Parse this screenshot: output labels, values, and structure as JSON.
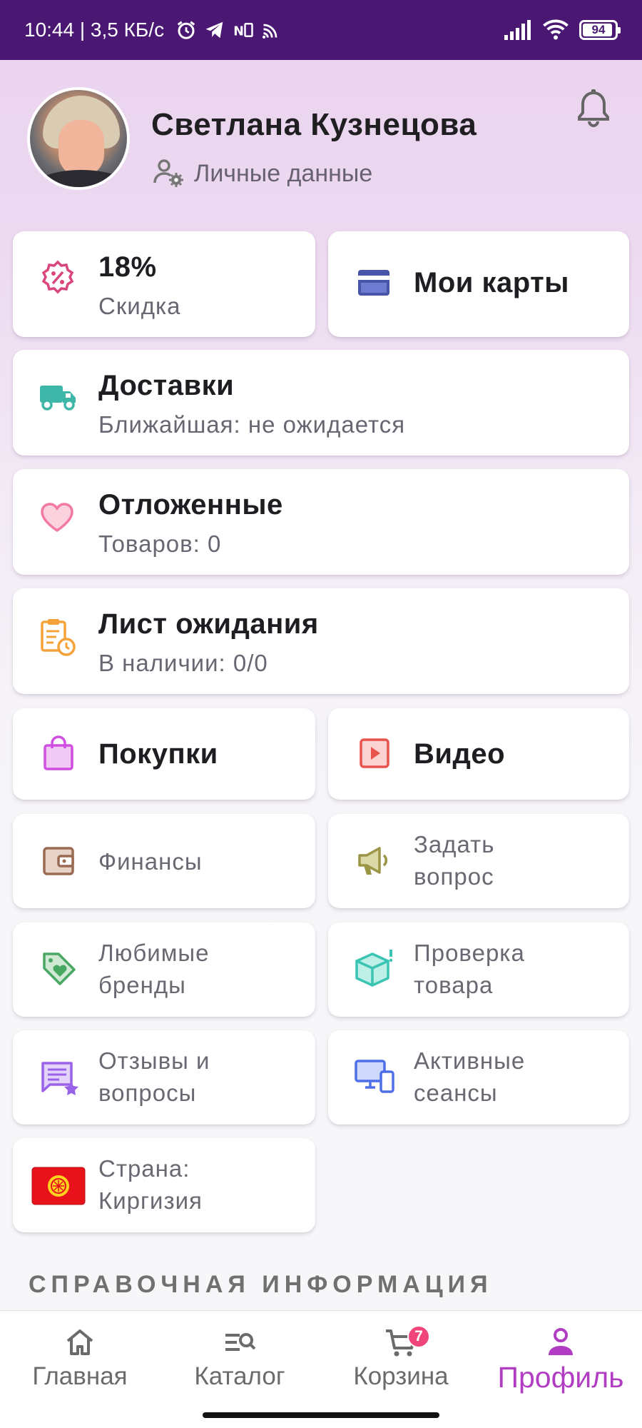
{
  "status_bar": {
    "time_speed": "10:44 | 3,5 КБ/с",
    "battery": "94",
    "battery_level": 0.94
  },
  "profile": {
    "name": "Светлана Кузнецова",
    "personal_data_link": "Личные данные"
  },
  "cards": {
    "discount": {
      "value": "18%",
      "label": "Скидка",
      "icon": "discount-badge-icon",
      "color": "#d9467e"
    },
    "my_cards": {
      "label": "Мои карты",
      "icon": "credit-card-icon",
      "color": "#4754a8"
    },
    "deliveries": {
      "title": "Доставки",
      "subtitle": "Ближайшая: не ожидается",
      "icon": "truck-icon",
      "color": "#3fb7a8"
    },
    "postponed": {
      "title": "Отложенные",
      "subtitle": "Товаров: 0",
      "icon": "heart-icon",
      "color": "#f07aa0"
    },
    "waitlist": {
      "title": "Лист ожидания",
      "subtitle": "В наличии: 0/0",
      "icon": "clipboard-clock-icon",
      "color": "#f5a23a"
    },
    "purchases": {
      "label": "Покупки",
      "icon": "shopping-bag-icon",
      "color": "#cf4fe0"
    },
    "video": {
      "label": "Видео",
      "icon": "video-play-icon",
      "color": "#e8534e"
    },
    "finances": {
      "label": "Финансы",
      "icon": "wallet-icon",
      "color": "#9a6a52"
    },
    "ask_question": {
      "line1": "Задать",
      "line2": "вопрос",
      "icon": "megaphone-icon",
      "color": "#9b9546"
    },
    "favorite_brands": {
      "line1": "Любимые",
      "line2": "бренды",
      "icon": "tag-heart-icon",
      "color": "#49a864"
    },
    "product_check": {
      "line1": "Проверка",
      "line2": "товара",
      "icon": "box-check-icon",
      "color": "#3cc4b2"
    },
    "reviews": {
      "line1": "Отзывы и",
      "line2": "вопросы",
      "icon": "reviews-star-icon",
      "color": "#9a62e8"
    },
    "sessions": {
      "line1": "Активные",
      "line2": "сеансы",
      "icon": "devices-icon",
      "color": "#4f6fe8"
    },
    "country": {
      "line1": "Страна:",
      "line2": "Киргизия",
      "icon": "kyrgyzstan-flag-icon",
      "color": "#e8121b"
    }
  },
  "section_title": "СПРАВОЧНАЯ ИНФОРМАЦИЯ",
  "bottom_nav": {
    "items": [
      {
        "label": "Главная",
        "icon": "home-icon"
      },
      {
        "label": "Каталог",
        "icon": "catalog-search-icon"
      },
      {
        "label": "Корзина",
        "icon": "cart-icon",
        "badge": "7"
      },
      {
        "label": "Профиль",
        "icon": "profile-icon",
        "active": true
      }
    ],
    "accent": "#b13ec2"
  }
}
